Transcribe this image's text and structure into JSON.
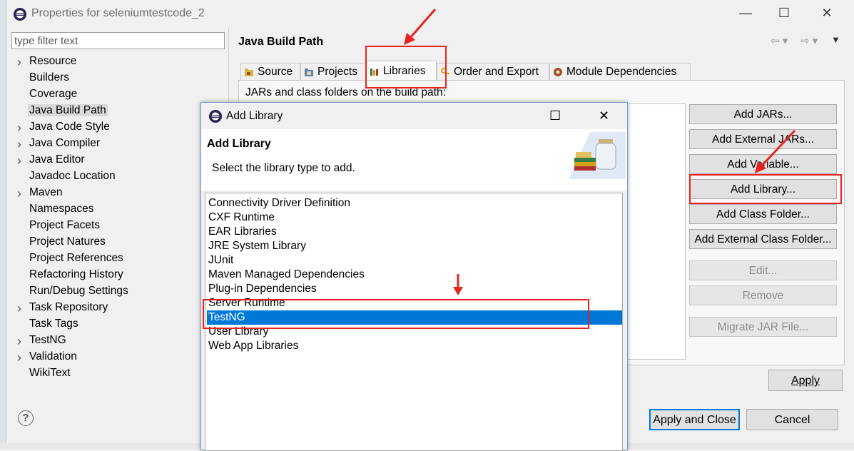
{
  "window": {
    "title": "Properties for seleniumtestcode_2",
    "minimize": "—",
    "maximize": "☐",
    "close": "✕"
  },
  "filter": {
    "placeholder": "type filter text"
  },
  "tree": [
    {
      "label": "Resource",
      "expandable": true
    },
    {
      "label": "Builders",
      "expandable": false
    },
    {
      "label": "Coverage",
      "expandable": false
    },
    {
      "label": "Java Build Path",
      "expandable": false,
      "selected": true
    },
    {
      "label": "Java Code Style",
      "expandable": true
    },
    {
      "label": "Java Compiler",
      "expandable": true
    },
    {
      "label": "Java Editor",
      "expandable": true
    },
    {
      "label": "Javadoc Location",
      "expandable": false
    },
    {
      "label": "Maven",
      "expandable": true
    },
    {
      "label": "Namespaces",
      "expandable": false
    },
    {
      "label": "Project Facets",
      "expandable": false
    },
    {
      "label": "Project Natures",
      "expandable": false
    },
    {
      "label": "Project References",
      "expandable": false
    },
    {
      "label": "Refactoring History",
      "expandable": false
    },
    {
      "label": "Run/Debug Settings",
      "expandable": false
    },
    {
      "label": "Task Repository",
      "expandable": true
    },
    {
      "label": "Task Tags",
      "expandable": false
    },
    {
      "label": "TestNG",
      "expandable": true
    },
    {
      "label": "Validation",
      "expandable": true
    },
    {
      "label": "WikiText",
      "expandable": false
    }
  ],
  "section_title": "Java Build Path",
  "tabs": [
    {
      "label": "Source",
      "icon": "source-folder-icon"
    },
    {
      "label": "Projects",
      "icon": "projects-icon"
    },
    {
      "label": "Libraries",
      "icon": "libraries-icon",
      "active": true
    },
    {
      "label": "Order and Export",
      "icon": "order-export-icon"
    },
    {
      "label": "Module Dependencies",
      "icon": "module-icon"
    }
  ],
  "jars_label": "JARs and class folders on the build path:",
  "right_buttons": [
    {
      "label": "Add JARs...",
      "enabled": true
    },
    {
      "label": "Add External JARs...",
      "enabled": true
    },
    {
      "label": "Add Variable...",
      "enabled": true
    },
    {
      "label": "Add Library...",
      "enabled": true
    },
    {
      "label": "Add Class Folder...",
      "enabled": true
    },
    {
      "label": "Add External Class Folder...",
      "enabled": true
    },
    {
      "label": "Edit...",
      "enabled": false
    },
    {
      "label": "Remove",
      "enabled": false
    },
    {
      "label": "Migrate JAR File...",
      "enabled": false
    }
  ],
  "bottom": {
    "apply": "Apply",
    "apply_and_close": "Apply and Close",
    "cancel": "Cancel",
    "help": "?"
  },
  "dialog": {
    "title": "Add Library",
    "heading": "Add Library",
    "description": "Select the library type to add.",
    "items": [
      "Connectivity Driver Definition",
      "CXF Runtime",
      "EAR Libraries",
      "JRE System Library",
      "JUnit",
      "Maven Managed Dependencies",
      "Plug-in Dependencies",
      "Server Runtime",
      "TestNG",
      "User Library",
      "Web App Libraries"
    ],
    "selected_index": 8
  },
  "colors": {
    "selection": "#0078d7",
    "annotation_red": "#e8231f"
  }
}
